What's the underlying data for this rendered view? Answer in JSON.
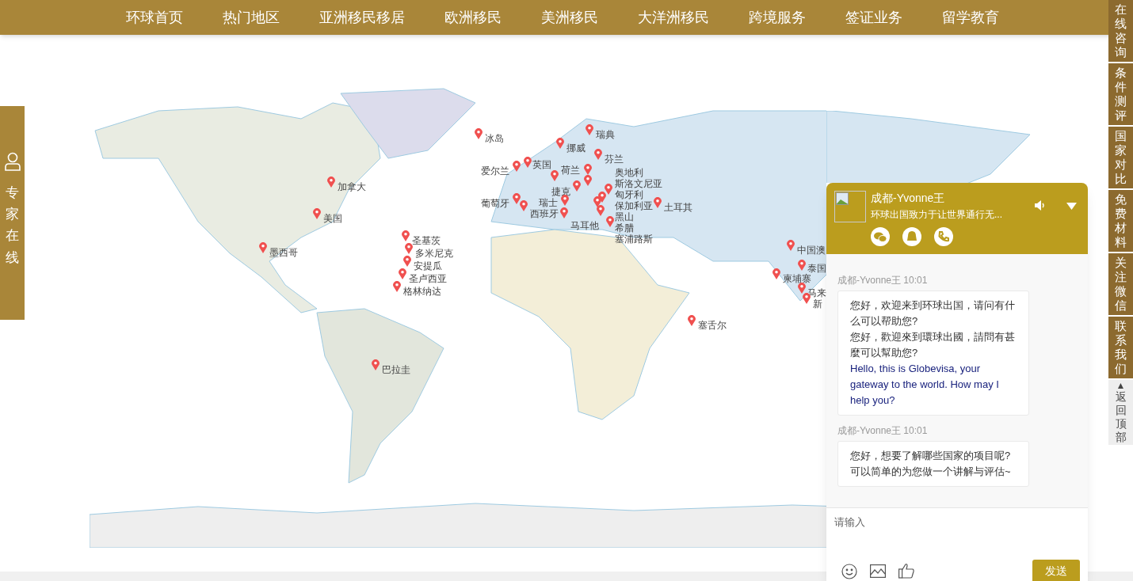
{
  "nav": {
    "items": [
      "环球首页",
      "热门地区",
      "亚洲移民移居",
      "欧洲移民",
      "美洲移民",
      "大洋洲移民",
      "跨境服务",
      "签证业务",
      "留学教育"
    ]
  },
  "expert_tab": {
    "label": "专家在线"
  },
  "map": {
    "pins": [
      {
        "label": "冰岛"
      },
      {
        "label": "瑞典"
      },
      {
        "label": "挪威"
      },
      {
        "label": "芬兰"
      },
      {
        "label": "爱尔兰"
      },
      {
        "label": "英国"
      },
      {
        "label": "荷兰"
      },
      {
        "label": "奥地利"
      },
      {
        "label": "斯洛文尼亚"
      },
      {
        "label": "捷克"
      },
      {
        "label": "匈牙利"
      },
      {
        "label": "保加利亚"
      },
      {
        "label": "土耳其"
      },
      {
        "label": "瑞士"
      },
      {
        "label": "黑山"
      },
      {
        "label": "葡萄牙"
      },
      {
        "label": "西班牙"
      },
      {
        "label": "马耳他"
      },
      {
        "label": "希腊"
      },
      {
        "label": "塞浦路斯"
      },
      {
        "label": "加拿大"
      },
      {
        "label": "美国"
      },
      {
        "label": "墨西哥"
      },
      {
        "label": "圣基茨"
      },
      {
        "label": "多米尼克"
      },
      {
        "label": "安提瓜"
      },
      {
        "label": "圣卢西亚"
      },
      {
        "label": "格林纳达"
      },
      {
        "label": "巴拉圭"
      },
      {
        "label": "塞舌尔"
      },
      {
        "label": "中国澳"
      },
      {
        "label": "泰国"
      },
      {
        "label": "柬埔寨"
      },
      {
        "label": "马来"
      },
      {
        "label": "新"
      }
    ]
  },
  "side_menu": {
    "items": [
      {
        "label": "在线咨询",
        "kind": "link"
      },
      {
        "label": "条件测评",
        "kind": "link"
      },
      {
        "label": "国家对比",
        "kind": "link"
      },
      {
        "label": "免费材料",
        "kind": "link"
      },
      {
        "label": "关注微信",
        "kind": "link"
      },
      {
        "label": "联系我们",
        "kind": "link"
      },
      {
        "label": "返回顶部",
        "kind": "top",
        "arrow": "▲"
      }
    ]
  },
  "chat": {
    "agent_name": "成都-Yvonne王",
    "tagline": "环球出国致力于让世界通行无...",
    "messages": [
      {
        "sender": "成都-Yvonne王 10:01",
        "paragraphs": [
          {
            "kind": "zh",
            "text": "您好，欢迎来到环球出国，请问有什么可以帮助您?"
          },
          {
            "kind": "zh",
            "text": "您好，歡迎來到環球出國，請問有甚麼可以幫助您?"
          },
          {
            "kind": "en",
            "text": "Hello, this is Globevisa, your gateway to the world. How may I help you?"
          }
        ]
      },
      {
        "sender": "成都-Yvonne王 10:01",
        "paragraphs": [
          {
            "kind": "zh",
            "text": "您好，想要了解哪些国家的项目呢?可以简单的为您做一个讲解与评估~"
          }
        ]
      }
    ],
    "input": {
      "placeholder": "请输入"
    },
    "send_button": "发送"
  }
}
